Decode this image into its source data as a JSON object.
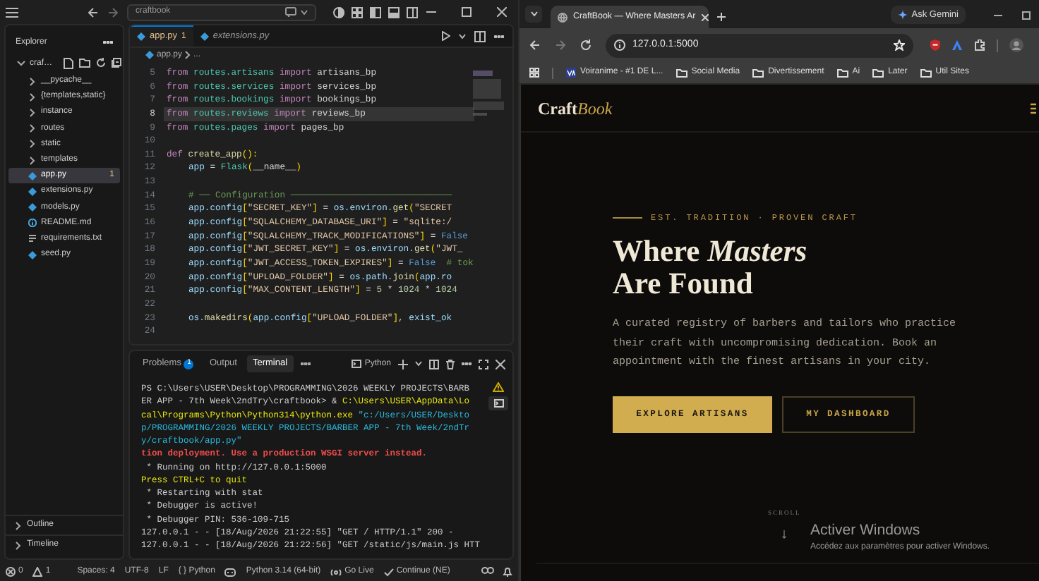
{
  "editor_window": {
    "title_bar": {
      "search": "craftbook"
    },
    "explorer": {
      "title": "Explorer",
      "tree": [
        {
          "label": "craf…",
          "kind": "folder",
          "expanded": true,
          "selected": false,
          "children": [
            {
              "label": "__pycache__",
              "kind": "folder",
              "expanded": false,
              "selected": false
            },
            {
              "label": "{templates,static}",
              "kind": "folder",
              "expanded": false,
              "selected": false
            },
            {
              "label": "instance",
              "kind": "folder",
              "expanded": false,
              "selected": false
            },
            {
              "label": "routes",
              "kind": "folder",
              "expanded": false,
              "selected": false
            },
            {
              "label": "static",
              "kind": "folder",
              "expanded": false,
              "selected": false
            },
            {
              "label": "templates",
              "kind": "folder",
              "expanded": false,
              "selected": false
            },
            {
              "label": "app.py",
              "kind": "python",
              "selected": true,
              "badge": "1"
            },
            {
              "label": "extensions.py",
              "kind": "python",
              "selected": false
            },
            {
              "label": "models.py",
              "kind": "python",
              "selected": false
            },
            {
              "label": "README.md",
              "kind": "info",
              "selected": false
            },
            {
              "label": "requirements.txt",
              "kind": "text",
              "selected": false
            },
            {
              "label": "seed.py",
              "kind": "python",
              "selected": false
            }
          ]
        }
      ],
      "sections": [
        {
          "label": "Outline",
          "expanded": false
        },
        {
          "label": "Timeline",
          "expanded": false
        }
      ]
    },
    "tabs": [
      {
        "label": "app.py",
        "badge": "1",
        "selected": true
      },
      {
        "label": "extensions.py",
        "selected": false
      }
    ],
    "breadcrumb": [
      "app.py",
      "..."
    ],
    "code": [
      {
        "number": "5",
        "indented": false,
        "highlighted": false,
        "tokens": [
          {
            "kind": "kw",
            "text": "from "
          },
          {
            "kind": "mod",
            "text": "routes.artisans"
          },
          {
            "kind": "kw",
            "text": " import "
          },
          {
            "kind": "pl",
            "text": "artisans_bp"
          }
        ]
      },
      {
        "number": "6",
        "indented": false,
        "highlighted": false,
        "tokens": [
          {
            "kind": "kw",
            "text": "from "
          },
          {
            "kind": "mod",
            "text": "routes.services"
          },
          {
            "kind": "kw",
            "text": " import "
          },
          {
            "kind": "pl",
            "text": "services_bp"
          }
        ]
      },
      {
        "number": "7",
        "indented": false,
        "highlighted": false,
        "tokens": [
          {
            "kind": "kw",
            "text": "from "
          },
          {
            "kind": "mod",
            "text": "routes.bookings"
          },
          {
            "kind": "kw",
            "text": " import "
          },
          {
            "kind": "pl",
            "text": "bookings_bp"
          }
        ]
      },
      {
        "number": "8",
        "indented": false,
        "highlighted": true,
        "tokens": [
          {
            "kind": "kw",
            "text": "from "
          },
          {
            "kind": "mod",
            "text": "routes.reviews"
          },
          {
            "kind": "kw",
            "text": " import "
          },
          {
            "kind": "pl",
            "text": "reviews_bp"
          }
        ]
      },
      {
        "number": "9",
        "indented": false,
        "highlighted": false,
        "tokens": [
          {
            "kind": "kw",
            "text": "from "
          },
          {
            "kind": "mod",
            "text": "routes.pages"
          },
          {
            "kind": "kw",
            "text": " import "
          },
          {
            "kind": "pl",
            "text": "pages_bp"
          }
        ]
      },
      {
        "number": "10",
        "highlighted": false
      },
      {
        "number": "11",
        "indented": false,
        "highlighted": false,
        "tokens": [
          {
            "kind": "kw",
            "text": "def "
          },
          {
            "kind": "fn",
            "text": "create_app"
          },
          {
            "kind": "br",
            "text": "():"
          }
        ]
      },
      {
        "number": "12",
        "indented": true,
        "highlighted": false,
        "tokens": [
          {
            "kind": "var",
            "text": "app"
          },
          {
            "kind": "pl",
            "text": " = "
          },
          {
            "kind": "mod",
            "text": "Flask"
          },
          {
            "kind": "br",
            "text": "("
          },
          {
            "kind": "pl",
            "text": "__name__"
          },
          {
            "kind": "br",
            "text": ")"
          }
        ]
      },
      {
        "number": "13",
        "highlighted": false
      },
      {
        "number": "14",
        "indented": true,
        "highlighted": false,
        "tokens": [
          {
            "kind": "cm",
            "text": "# ── Configuration ──────────────────────────────"
          }
        ]
      },
      {
        "number": "15",
        "indented": true,
        "highlighted": false,
        "tokens": [
          {
            "kind": "var",
            "text": "app.config"
          },
          {
            "kind": "br",
            "text": "["
          },
          {
            "kind": "str",
            "text": "\"SECRET_KEY\""
          },
          {
            "kind": "br",
            "text": "]"
          },
          {
            "kind": "pl",
            "text": " = "
          },
          {
            "kind": "var",
            "text": "os.environ."
          },
          {
            "kind": "fn",
            "text": "get"
          },
          {
            "kind": "br",
            "text": "("
          },
          {
            "kind": "str",
            "text": "\"SECRET"
          }
        ]
      },
      {
        "number": "16",
        "indented": true,
        "highlighted": false,
        "tokens": [
          {
            "kind": "var",
            "text": "app.config"
          },
          {
            "kind": "br",
            "text": "["
          },
          {
            "kind": "str",
            "text": "\"SQLALCHEMY_DATABASE_URI\""
          },
          {
            "kind": "br",
            "text": "]"
          },
          {
            "kind": "pl",
            "text": " = "
          },
          {
            "kind": "str",
            "text": "\"sqlite:/"
          }
        ]
      },
      {
        "number": "17",
        "indented": true,
        "highlighted": false,
        "tokens": [
          {
            "kind": "var",
            "text": "app.config"
          },
          {
            "kind": "br",
            "text": "["
          },
          {
            "kind": "str",
            "text": "\"SQLALCHEMY_TRACK_MODIFICATIONS\""
          },
          {
            "kind": "br",
            "text": "]"
          },
          {
            "kind": "pl",
            "text": " = "
          },
          {
            "kind": "const",
            "text": "False"
          }
        ]
      },
      {
        "number": "18",
        "indented": true,
        "highlighted": false,
        "tokens": [
          {
            "kind": "var",
            "text": "app.config"
          },
          {
            "kind": "br",
            "text": "["
          },
          {
            "kind": "str",
            "text": "\"JWT_SECRET_KEY\""
          },
          {
            "kind": "br",
            "text": "]"
          },
          {
            "kind": "pl",
            "text": " = "
          },
          {
            "kind": "var",
            "text": "os.environ."
          },
          {
            "kind": "fn",
            "text": "get"
          },
          {
            "kind": "br",
            "text": "("
          },
          {
            "kind": "str",
            "text": "\"JWT_"
          }
        ]
      },
      {
        "number": "19",
        "indented": true,
        "highlighted": false,
        "tokens": [
          {
            "kind": "var",
            "text": "app.config"
          },
          {
            "kind": "br",
            "text": "["
          },
          {
            "kind": "str",
            "text": "\"JWT_ACCESS_TOKEN_EXPIRES\""
          },
          {
            "kind": "br",
            "text": "]"
          },
          {
            "kind": "pl",
            "text": " = "
          },
          {
            "kind": "const",
            "text": "False"
          },
          {
            "kind": "cm",
            "text": "  # tok"
          }
        ]
      },
      {
        "number": "20",
        "indented": true,
        "highlighted": false,
        "tokens": [
          {
            "kind": "var",
            "text": "app.config"
          },
          {
            "kind": "br",
            "text": "["
          },
          {
            "kind": "str",
            "text": "\"UPLOAD_FOLDER\""
          },
          {
            "kind": "br",
            "text": "]"
          },
          {
            "kind": "pl",
            "text": " = "
          },
          {
            "kind": "var",
            "text": "os.path."
          },
          {
            "kind": "fn",
            "text": "join"
          },
          {
            "kind": "br",
            "text": "("
          },
          {
            "kind": "var",
            "text": "app.ro"
          }
        ]
      },
      {
        "number": "21",
        "indented": true,
        "highlighted": false,
        "tokens": [
          {
            "kind": "var",
            "text": "app.config"
          },
          {
            "kind": "br",
            "text": "["
          },
          {
            "kind": "str",
            "text": "\"MAX_CONTENT_LENGTH\""
          },
          {
            "kind": "br",
            "text": "]"
          },
          {
            "kind": "pl",
            "text": " = "
          },
          {
            "kind": "num",
            "text": "5"
          },
          {
            "kind": "pl",
            "text": " * "
          },
          {
            "kind": "num",
            "text": "1024"
          },
          {
            "kind": "pl",
            "text": " * "
          },
          {
            "kind": "num",
            "text": "1024"
          }
        ]
      },
      {
        "number": "22",
        "highlighted": false
      },
      {
        "number": "23",
        "indented": true,
        "highlighted": false,
        "tokens": [
          {
            "kind": "var",
            "text": "os."
          },
          {
            "kind": "fn",
            "text": "makedirs"
          },
          {
            "kind": "br",
            "text": "("
          },
          {
            "kind": "var",
            "text": "app.config"
          },
          {
            "kind": "br",
            "text": "["
          },
          {
            "kind": "str",
            "text": "\"UPLOAD_FOLDER\""
          },
          {
            "kind": "br",
            "text": "]"
          },
          {
            "kind": "pl",
            "text": ", "
          },
          {
            "kind": "var",
            "text": "exist_ok"
          }
        ]
      },
      {
        "number": "24",
        "highlighted": false
      }
    ],
    "panel": {
      "tabs": [
        {
          "label": "Problems",
          "badge": "1",
          "selected": false
        },
        {
          "label": "Output",
          "selected": false
        },
        {
          "label": "Terminal",
          "selected": true
        }
      ],
      "terminal_name": "Python",
      "terminal": [
        [
          {
            "kind": "pl",
            "text": "PS C:\\Users\\USER\\Desktop\\PROGRAMMING\\2026 WEEKLY PROJECTS\\BARB"
          }
        ],
        [
          {
            "kind": "pl",
            "text": "ER APP - 7th Week\\2ndTry\\craftbook> & "
          },
          {
            "kind": "yl",
            "text": "C:\\Users\\USER\\AppData\\Lo"
          }
        ],
        [
          {
            "kind": "yl",
            "text": "cal\\Programs\\Python\\Python314\\python.exe "
          },
          {
            "kind": "bl",
            "text": "\"c:/Users/USER/Deskto"
          }
        ],
        [
          {
            "kind": "bl",
            "text": "p/PROGRAMMING/2026 WEEKLY PROJECTS/BARBER APP - 7th Week/2ndTr"
          }
        ],
        [
          {
            "kind": "bl",
            "text": "y/craftbook/app.py\""
          }
        ],
        [
          {
            "kind": "rd",
            "text": "tion deployment. Use a production WSGI server instead."
          }
        ],
        [
          {
            "kind": "pl",
            "text": " * Running on http://127.0.0.1:5000"
          }
        ],
        [
          {
            "kind": "yl",
            "text": "Press CTRL+C to quit"
          }
        ],
        [
          {
            "kind": "pl",
            "text": " * Restarting with stat"
          }
        ],
        [
          {
            "kind": "pl",
            "text": " * Debugger is active!"
          }
        ],
        [
          {
            "kind": "pl",
            "text": " * Debugger PIN: 536-109-715"
          }
        ],
        [
          {
            "kind": "pl",
            "text": "127.0.0.1 - - [18/Aug/2026 21:22:55] \"GET / HTTP/1.1\" 200 -"
          }
        ],
        [
          {
            "kind": "pl",
            "text": "127.0.0.1 - - [18/Aug/2026 21:22:56] \"GET /static/js/main.js HTT"
          }
        ]
      ]
    },
    "status_bar": [
      {
        "kind": "error",
        "text": "0"
      },
      {
        "kind": "warning",
        "text": "1"
      },
      {
        "kind": "plain",
        "text": "Spaces: 4"
      },
      {
        "kind": "plain",
        "text": "UTF-8"
      },
      {
        "kind": "plain",
        "text": "LF"
      },
      {
        "kind": "plain",
        "text": "{ } Python"
      },
      {
        "kind": "copilot",
        "text": "Python 3.14 (64-bit)"
      },
      {
        "kind": "broadcast",
        "text": "Go Live"
      },
      {
        "kind": "check",
        "text": "Continue (NE)"
      }
    ]
  },
  "browser": {
    "tabs": [
      {
        "title": "CraftBook — Where Masters Ar",
        "selected": true
      }
    ],
    "ask_button": "Ask Gemini",
    "url": "127.0.0.1:5000",
    "bookmarks": [
      {
        "label": "Voiranime - #1 DE L...",
        "kind": "site"
      },
      {
        "label": "Social Media",
        "kind": "folder"
      },
      {
        "label": "Divertissement",
        "kind": "folder"
      },
      {
        "label": "Ai",
        "kind": "folder"
      },
      {
        "label": "Later",
        "kind": "folder"
      },
      {
        "label": "Util Sites",
        "kind": "folder"
      }
    ],
    "page": {
      "logo": [
        {
          "kind": "plain",
          "text": "Craft"
        },
        {
          "kind": "accent",
          "text": "Book"
        }
      ],
      "eyebrow": "EST. TRADITION · PROVEN CRAFT",
      "heading": "Where *Masters* Are Found",
      "intro": "A curated registry of barbers and tailors who practice their craft with uncompromising dedication. Book an appointment with the finest artisans in your city.",
      "buttons": [
        {
          "label": "EXPLORE ARTISANS",
          "kind": "primary"
        },
        {
          "label": "MY DASHBOARD",
          "kind": "outline"
        }
      ],
      "scroll_hint": "SCROLL"
    }
  },
  "os_notice": {
    "title": "Activer Windows",
    "text": "Accédez aux paramètres pour activer Windows."
  }
}
